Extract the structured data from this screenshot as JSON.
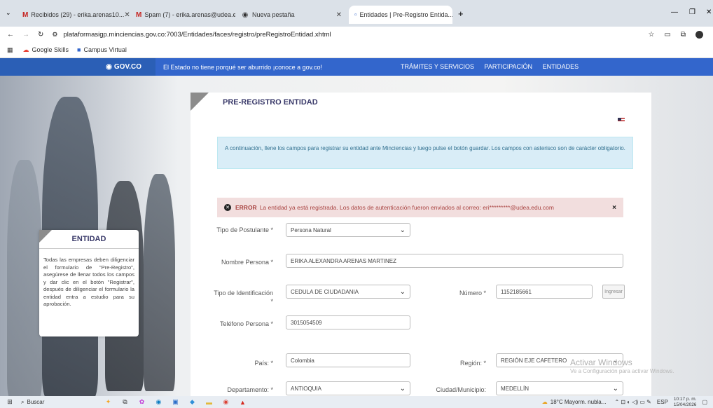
{
  "browser": {
    "tabs": [
      {
        "label": "Recibidos (29) - erika.arenas10...",
        "icon": "gmail-icon"
      },
      {
        "label": "Spam (7) - erika.arenas@udea.e...",
        "icon": "gmail-icon"
      },
      {
        "label": "Nueva pestaña",
        "icon": "chrome-icon"
      },
      {
        "label": "Entidades | Pre-Registro Entida...",
        "icon": "page-icon"
      }
    ],
    "new_tab": "+",
    "url": "plataformasigp.minciencias.gov.co:7003/Entidades/faces/registro/preRegistroEntidad.xhtml",
    "bookmarks": [
      "Google Skills",
      "Campus Virtual"
    ]
  },
  "govbar": {
    "logo": "GOV.CO",
    "tagline": "El Estado no tiene porqué ser aburrido ¡conoce a gov.co!",
    "links": [
      "TRÁMITES Y SERVICIOS",
      "PARTICIPACIÓN",
      "ENTIDADES"
    ]
  },
  "sidebar": {
    "title": "ENTIDAD",
    "text": "Todas las empresas deben diligenciar el formulario de \"Pre-Registro\", asegúrese de llenar todos los campos y dar clic en el botón \"Registrar\", después de diligenciar el formulario la entidad entra a estudio para su aprobación."
  },
  "form": {
    "title": "PRE-REGISTRO ENTIDAD",
    "info": "A continuación, llene los campos para registrar su entidad ante Minciencias y luego pulse el botón guardar. Los campos con asterisco son de carácter obligatorio.",
    "error_label": "ERROR",
    "error_text": "La entidad ya está registrada. Los datos de autenticación fueron enviados al correo: eri*********@udea.edu.com",
    "error_close": "×",
    "tipo_postulante_label": "Tipo de Postulante *",
    "tipo_postulante_value": "Persona Natural",
    "nombre_label": "Nombre Persona *",
    "nombre_value": "ERIKA ALEXANDRA ARENAS MARTINEZ",
    "tipo_id_label": "Tipo de Identificación *",
    "tipo_id_value": "CEDULA DE CIUDADANIA",
    "numero_label": "Número *",
    "numero_value": "1152185661",
    "ingresar": "Ingresar",
    "telefono_label": "Teléfono Persona *",
    "telefono_value": "3015054509",
    "pais_label": "País: *",
    "pais_value": "Colombia",
    "region_label": "Región: *",
    "region_value": "REGIÓN EJE CAFETERO",
    "departamento_label": "Departamento: *",
    "departamento_value": "ANTIOQUIA",
    "ciudad_label": "Ciudad/Municipio:",
    "ciudad_value": "MEDELLÍN"
  },
  "watermark": {
    "line1": "Activar Windows",
    "line2": "Ve a Configuración para activar Windows."
  },
  "taskbar": {
    "search": "Buscar",
    "weather": "18°C  Mayorm. nubla...",
    "lang": "ESP",
    "time": "10:17 p. m.",
    "date": "15/04/2026"
  },
  "colors": {
    "govbar": "#3366cc",
    "error_bg": "#f2dede",
    "info_bg": "#d9edf7",
    "title": "#3a3a6a"
  }
}
